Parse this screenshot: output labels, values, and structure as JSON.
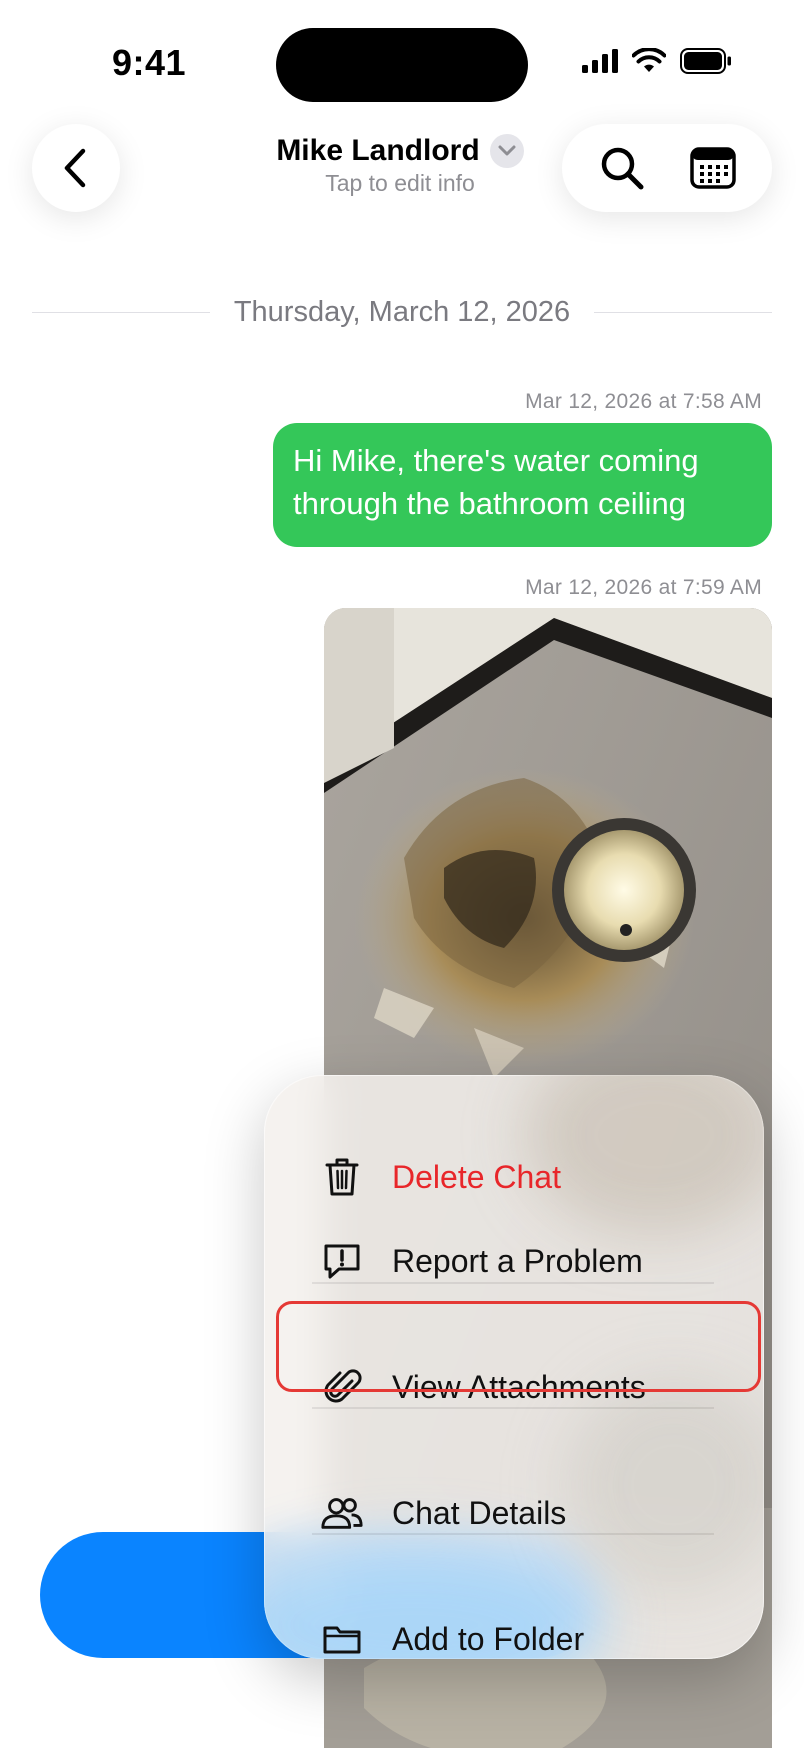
{
  "status_bar": {
    "time": "9:41",
    "icons": [
      "cellular-signal-icon",
      "wifi-icon",
      "battery-icon"
    ]
  },
  "header": {
    "back_icon": "chevron-left-icon",
    "contact_name": "Mike Landlord",
    "contact_subtitle": "Tap to edit info",
    "actions": [
      "search-icon",
      "calendar-icon"
    ]
  },
  "conversation": {
    "date_divider": "Thursday, March 12, 2026",
    "messages": [
      {
        "timestamp": "Mar 12, 2026 at 7:58 AM",
        "type": "text",
        "text": "Hi Mike, there's water coming through the bathroom ceiling"
      },
      {
        "timestamp": "Mar 12, 2026 at 7:59 AM",
        "type": "image"
      }
    ]
  },
  "share_button": {
    "icon": "share-icon"
  },
  "context_menu": {
    "items": [
      {
        "label": "Delete Chat",
        "icon": "trash-icon",
        "style": "destructive"
      },
      {
        "label": "Report a Problem",
        "icon": "report-problem-icon"
      },
      {
        "label": "View Attachments",
        "icon": "paperclip-icon",
        "highlighted": true
      },
      {
        "label": "Chat Details",
        "icon": "people-icon"
      },
      {
        "label": "Add to Folder",
        "icon": "folder-icon"
      }
    ]
  },
  "colors": {
    "sent_bubble": "#34c759",
    "share_button": "#0a84ff",
    "destructive": "#e8262a",
    "highlight_outline": "#e53935"
  }
}
